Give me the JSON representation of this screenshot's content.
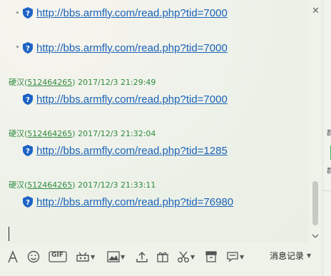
{
  "messages": [
    {
      "sender": null,
      "link": "http://bbs.armfly.com/read.php?tid=7000"
    },
    {
      "sender": null,
      "link": "http://bbs.armfly.com/read.php?tid=7000"
    },
    {
      "sender": {
        "name": "硬汉",
        "qq": "512464265",
        "time": "2017/12/3 21:29:49"
      },
      "link": "http://bbs.armfly.com/read.php?tid=7000"
    },
    {
      "sender": {
        "name": "硬汉",
        "qq": "512464265",
        "time": "2017/12/3 21:32:04"
      },
      "link": "http://bbs.armfly.com/read.php?tid=1285"
    },
    {
      "sender": {
        "name": "硬汉",
        "qq": "512464265",
        "time": "2017/12/3 21:33:11"
      },
      "link": "http://bbs.armfly.com/read.php?tid=76980"
    }
  ],
  "toolbar": {
    "history_label": "消息记录",
    "gif_label": "GIF",
    "icons": [
      "font-icon",
      "emoji-icon",
      "gif-icon",
      "game-icon",
      "image-icon",
      "upload-icon",
      "gift-icon",
      "screenshot-icon",
      "archive-icon",
      "chat-bubble-icon"
    ]
  },
  "side_panel": {
    "labels": [
      "群",
      "群"
    ]
  },
  "colors": {
    "link": "#1a62b8",
    "sender": "#2e8b3e",
    "shield": "#1d63c5"
  }
}
